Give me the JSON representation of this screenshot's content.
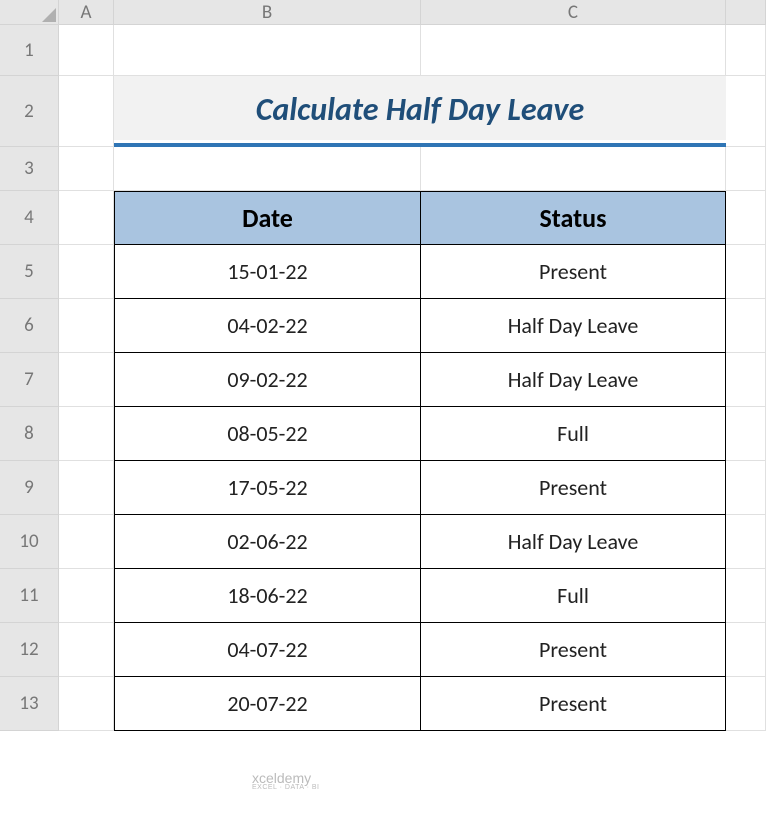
{
  "col_labels": [
    "A",
    "B",
    "C"
  ],
  "row_labels": [
    "1",
    "2",
    "3",
    "4",
    "5",
    "6",
    "7",
    "8",
    "9",
    "10",
    "11",
    "12",
    "13"
  ],
  "title": "Calculate Half Day Leave",
  "table": {
    "headers": {
      "date": "Date",
      "status": "Status"
    },
    "rows": [
      {
        "date": "15-01-22",
        "status": "Present"
      },
      {
        "date": "04-02-22",
        "status": "Half Day Leave"
      },
      {
        "date": "09-02-22",
        "status": "Half Day Leave"
      },
      {
        "date": "08-05-22",
        "status": "Full"
      },
      {
        "date": "17-05-22",
        "status": "Present"
      },
      {
        "date": "02-06-22",
        "status": "Half Day Leave"
      },
      {
        "date": "18-06-22",
        "status": "Full"
      },
      {
        "date": "04-07-22",
        "status": "Present"
      },
      {
        "date": "20-07-22",
        "status": "Present"
      }
    ]
  },
  "watermark": {
    "brand": "xceldemy",
    "tagline": "EXCEL · DATA · BI"
  }
}
